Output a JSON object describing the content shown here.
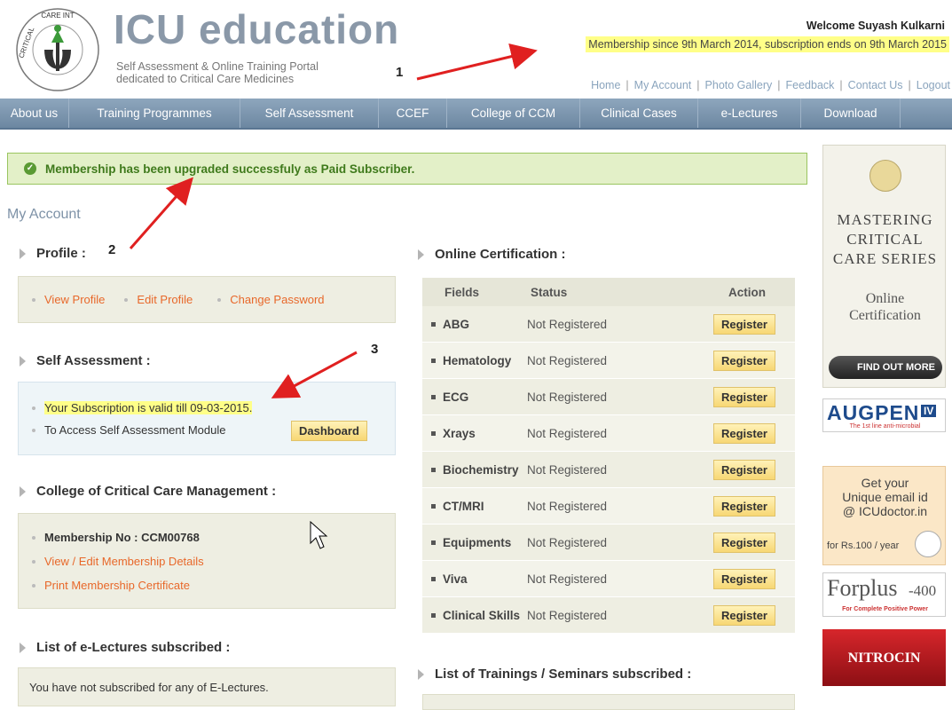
{
  "header": {
    "brand": "ICU education",
    "tagline_1": "Self Assessment & Online Training Portal",
    "tagline_2": "dedicated to Critical Care Medicines",
    "seal_text": "ACCRETE CRITICAL CARE INTERNATIONAL LLP",
    "welcome": "Welcome Suyash Kulkarni",
    "membership": "Membership since 9th March 2014, subscription ends on 9th March 2015",
    "links": [
      "Home",
      "My Account",
      "Photo Gallery",
      "Feedback",
      "Contact Us",
      "Logout"
    ]
  },
  "nav": [
    "About us",
    "Training Programmes",
    "Self Assessment",
    "CCEF",
    "College of CCM",
    "Clinical Cases",
    "e-Lectures",
    "Download"
  ],
  "success_message": "Membership has been upgraded successfuly as Paid Subscriber.",
  "page_title": "My Account",
  "profile": {
    "title": "Profile :",
    "links": [
      "View Profile",
      "Edit Profile",
      "Change Password"
    ]
  },
  "self_assessment": {
    "title": "Self Assessment :",
    "validity": "Your Subscription is valid till 09-03-2015.",
    "access": "To Access Self Assessment Module",
    "button": "Dashboard"
  },
  "college": {
    "title": "College of Critical Care Management :",
    "membership_no": "Membership No : CCM00768",
    "view_edit": "View / Edit Membership Details",
    "print": "Print Membership Certificate"
  },
  "electures": {
    "title": "List of e-Lectures subscribed :",
    "message": "You have not subscribed for any of E-Lectures."
  },
  "certification": {
    "title": "Online Certification :",
    "headers": [
      "Fields",
      "Status",
      "Action"
    ],
    "rows": [
      {
        "field": "ABG",
        "status": "Not Registered",
        "action": "Register"
      },
      {
        "field": "Hematology",
        "status": "Not Registered",
        "action": "Register"
      },
      {
        "field": "ECG",
        "status": "Not Registered",
        "action": "Register"
      },
      {
        "field": "Xrays",
        "status": "Not Registered",
        "action": "Register"
      },
      {
        "field": "Biochemistry",
        "status": "Not Registered",
        "action": "Register"
      },
      {
        "field": "CT/MRI",
        "status": "Not Registered",
        "action": "Register"
      },
      {
        "field": "Equipments",
        "status": "Not Registered",
        "action": "Register"
      },
      {
        "field": "Viva",
        "status": "Not Registered",
        "action": "Register"
      },
      {
        "field": "Clinical Skills",
        "status": "Not Registered",
        "action": "Register"
      }
    ]
  },
  "trainings": {
    "title": "List of Trainings / Seminars subscribed :"
  },
  "sidebar": {
    "mastering_1": "MASTERING",
    "mastering_2": "CRITICAL",
    "mastering_3": "CARE SERIES",
    "online_1": "Online",
    "online_2": "Certification",
    "find_out": "FIND OUT MORE",
    "augpen": "AUGPEN",
    "augpen_sub": "IV",
    "augpen_tag": "The 1st line anti-microbial",
    "email_1": "Get your",
    "email_2": "Unique email id",
    "email_3": "@ ICUdoctor.in",
    "email_4": "for Rs.100 / year",
    "forplus": "Forplus",
    "forplus_num": "-400",
    "forplus_tag": "For Complete Positive Power",
    "nitrocin": "NITROCIN"
  },
  "annotations": [
    "1",
    "2",
    "3"
  ],
  "colors": {
    "nav": "#7a93ab",
    "accent_orange": "#e8682a",
    "success_green": "#3f7a1c",
    "highlight": "#ffff88"
  }
}
